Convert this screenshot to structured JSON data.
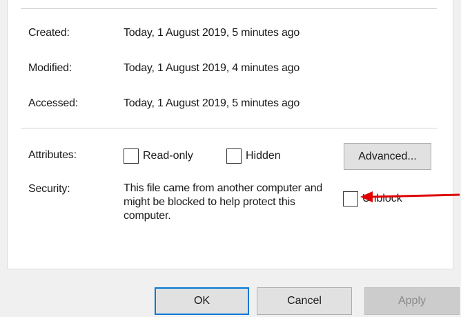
{
  "general": {
    "created_label": "Created:",
    "created_value": "Today, 1 August 2019, 5 minutes ago",
    "modified_label": "Modified:",
    "modified_value": "Today, 1 August 2019, 4 minutes ago",
    "accessed_label": "Accessed:",
    "accessed_value": "Today, 1 August 2019, 5 minutes ago"
  },
  "attributes": {
    "label": "Attributes:",
    "read_only_label": "Read-only",
    "read_only_checked": false,
    "hidden_label": "Hidden",
    "hidden_checked": false,
    "advanced_button": "Advanced..."
  },
  "security": {
    "label": "Security:",
    "message": "This file came from another computer and might be blocked to help protect this computer.",
    "unblock_label": "Unblock",
    "unblock_checked": false
  },
  "footer": {
    "ok_button": "OK",
    "cancel_button": "Cancel",
    "apply_button": "Apply"
  },
  "annotation": {
    "arrow_color": "#e00000"
  },
  "colors": {
    "default_button_border": "#0078d7"
  }
}
